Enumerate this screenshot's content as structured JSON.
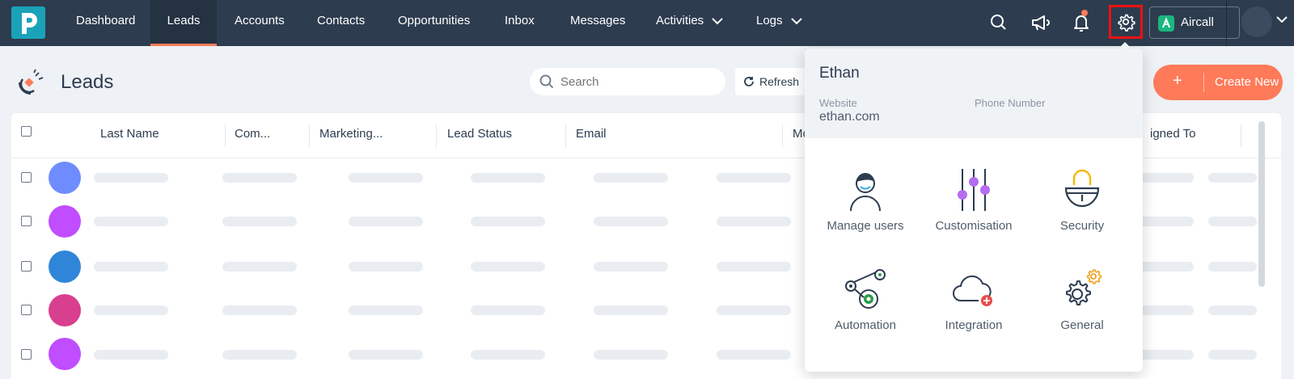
{
  "nav": {
    "items": [
      {
        "label": "Dashboard"
      },
      {
        "label": "Leads"
      },
      {
        "label": "Accounts"
      },
      {
        "label": "Contacts"
      },
      {
        "label": "Opportunities"
      },
      {
        "label": "Inbox"
      },
      {
        "label": "Messages"
      },
      {
        "label": "Activities"
      },
      {
        "label": "Logs"
      }
    ],
    "active_item": "Leads",
    "aircall_label": "Aircall"
  },
  "page": {
    "title": "Leads",
    "search_placeholder": "Search",
    "refresh_label": "Refresh",
    "create_new_label": "Create New",
    "create_new_icon": "+"
  },
  "table": {
    "columns": [
      "Last Name",
      "Com...",
      "Marketing...",
      "Lead Status",
      "Email",
      "Mo",
      "igned To"
    ],
    "row_avatar_colors": [
      "#6f8cff",
      "#c04dff",
      "#2f86d8",
      "#d83f8e",
      "#c04dff"
    ]
  },
  "settings_menu": {
    "name": "Ethan",
    "website_label": "Website",
    "website_value": "ethan.com",
    "phone_label": "Phone Number",
    "tiles": [
      {
        "label": "Manage users",
        "icon": "user-icon"
      },
      {
        "label": "Customisation",
        "icon": "sliders-icon"
      },
      {
        "label": "Security",
        "icon": "lock-icon"
      },
      {
        "label": "Automation",
        "icon": "automation-icon"
      },
      {
        "label": "Integration",
        "icon": "cloud-plus-icon"
      },
      {
        "label": "General",
        "icon": "gears-icon"
      }
    ]
  },
  "colors": {
    "nav_bg": "#2d3c4f",
    "accent": "#ff7a59",
    "highlight_border": "#ee1111"
  }
}
